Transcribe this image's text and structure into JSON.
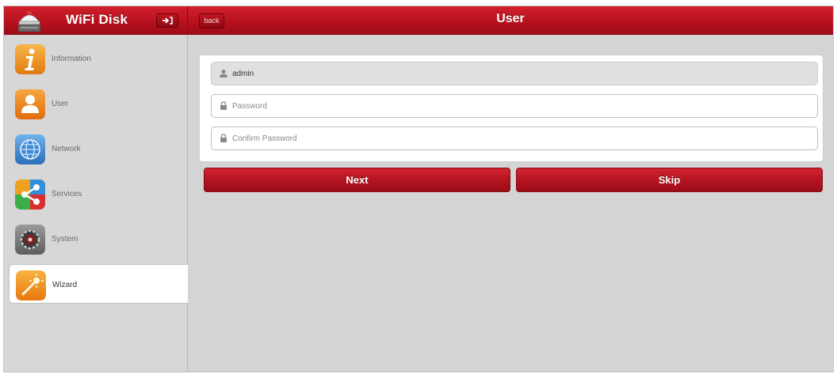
{
  "header": {
    "app_title": "WiFi Disk",
    "back_label": "back",
    "page_title": "User",
    "logo_icon": "router-dome-icon",
    "logout_icon": "logout-arrow-icon"
  },
  "sidebar": {
    "items": [
      {
        "label": "Information",
        "icon": "info-icon",
        "active": false
      },
      {
        "label": "User",
        "icon": "user-icon",
        "active": false
      },
      {
        "label": "Network",
        "icon": "globe-icon",
        "active": false
      },
      {
        "label": "Services",
        "icon": "share-icon",
        "active": false
      },
      {
        "label": "System",
        "icon": "gear-icon",
        "active": false
      },
      {
        "label": "Wizard",
        "icon": "wand-icon",
        "active": true
      }
    ]
  },
  "form": {
    "username_value": "admin",
    "password_placeholder": "Password",
    "confirm_placeholder": "Confirm Password"
  },
  "actions": {
    "next_label": "Next",
    "skip_label": "Skip"
  },
  "colors": {
    "brand_red": "#b8121e",
    "background": "#d4d4d4"
  }
}
